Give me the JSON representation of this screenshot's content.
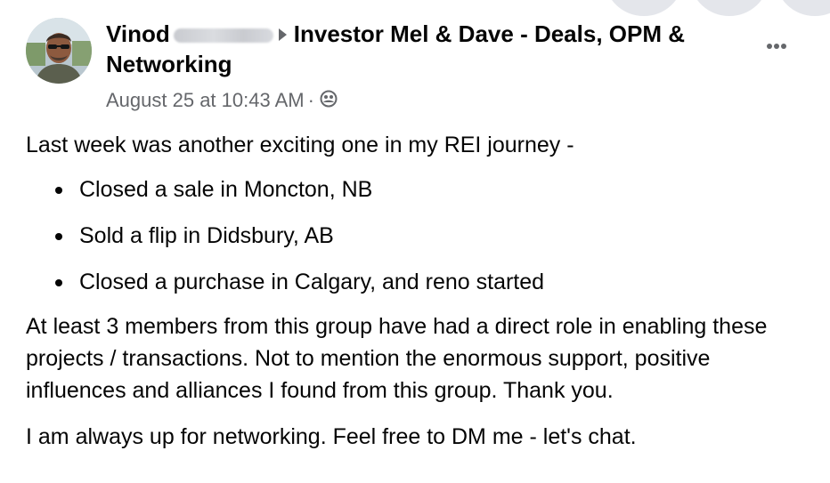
{
  "post": {
    "author_name": "Vinod",
    "group_name": "Investor Mel & Dave - Deals, OPM & Networking",
    "timestamp": "August 25 at 10:43 AM",
    "separator": "·",
    "audience_icon": "group-audience-icon",
    "more_icon": "more-options-icon",
    "intro": "Last week was another exciting one in my REI journey -",
    "bullets": [
      "Closed a sale in Moncton, NB",
      "Sold a flip in Didsbury, AB",
      "Closed a purchase in Calgary, and reno started"
    ],
    "paragraph_2": "At least 3 members from this group have had a direct role in enabling these projects / transactions. Not to mention the enormous support, positive influences and alliances I found from this group. Thank you.",
    "paragraph_3": "I am always up for networking. Feel free to DM me - let's chat."
  },
  "colors": {
    "primary_text": "#050505",
    "secondary_text": "#65676b",
    "background": "#ffffff"
  }
}
